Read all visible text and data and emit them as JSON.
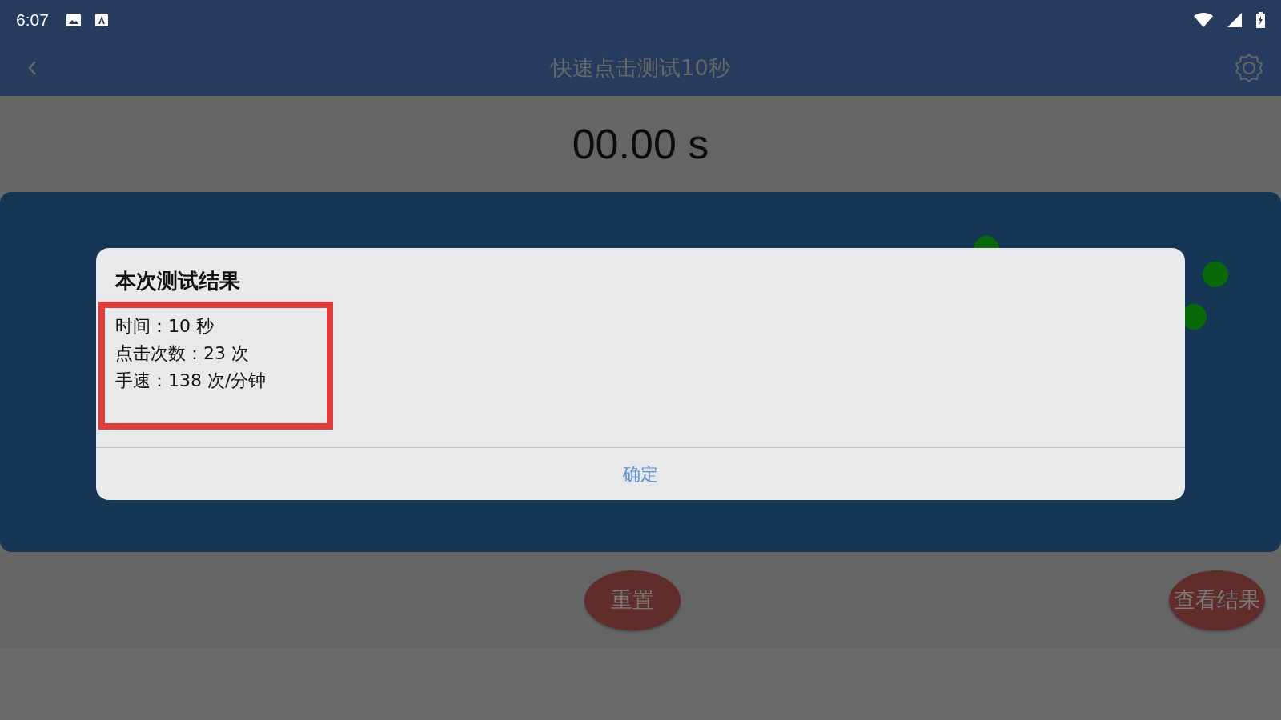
{
  "status_bar": {
    "time": "6:07"
  },
  "app_bar": {
    "title": "快速点击测试10秒"
  },
  "timer": "00.00 s",
  "dialog": {
    "title": "本次测试结果",
    "lines": [
      "时间：10 秒",
      "点击次数：23 次",
      "手速：138 次/分钟"
    ],
    "button": "确定"
  },
  "buttons": [
    "重置",
    "查看结果"
  ]
}
